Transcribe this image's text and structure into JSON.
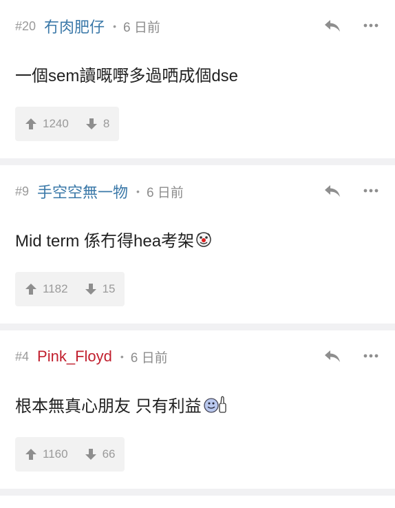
{
  "posts": [
    {
      "floor": "#20",
      "username": "冇肉肥仔",
      "username_color": "#3a78a8",
      "separator": "•",
      "time": "6 日前",
      "content": "一個sem讀嘅嘢多過哂成個dse",
      "emoji": null,
      "upvotes": "1240",
      "downvotes": "8"
    },
    {
      "floor": "#9",
      "username": "手空空無一物",
      "username_color": "#3a78a8",
      "separator": "•",
      "time": "6 日前",
      "content": "Mid term 係冇得hea考架",
      "emoji": "clown-emoji-icon",
      "upvotes": "1182",
      "downvotes": "15"
    },
    {
      "floor": "#4",
      "username": "Pink_Floyd",
      "username_color": "#c11f2e",
      "separator": "•",
      "time": "6 日前",
      "content": "根本無真心朋友 只有利益",
      "emoji": "thumbs-up-smiley-icon",
      "upvotes": "1160",
      "downvotes": "66"
    }
  ]
}
